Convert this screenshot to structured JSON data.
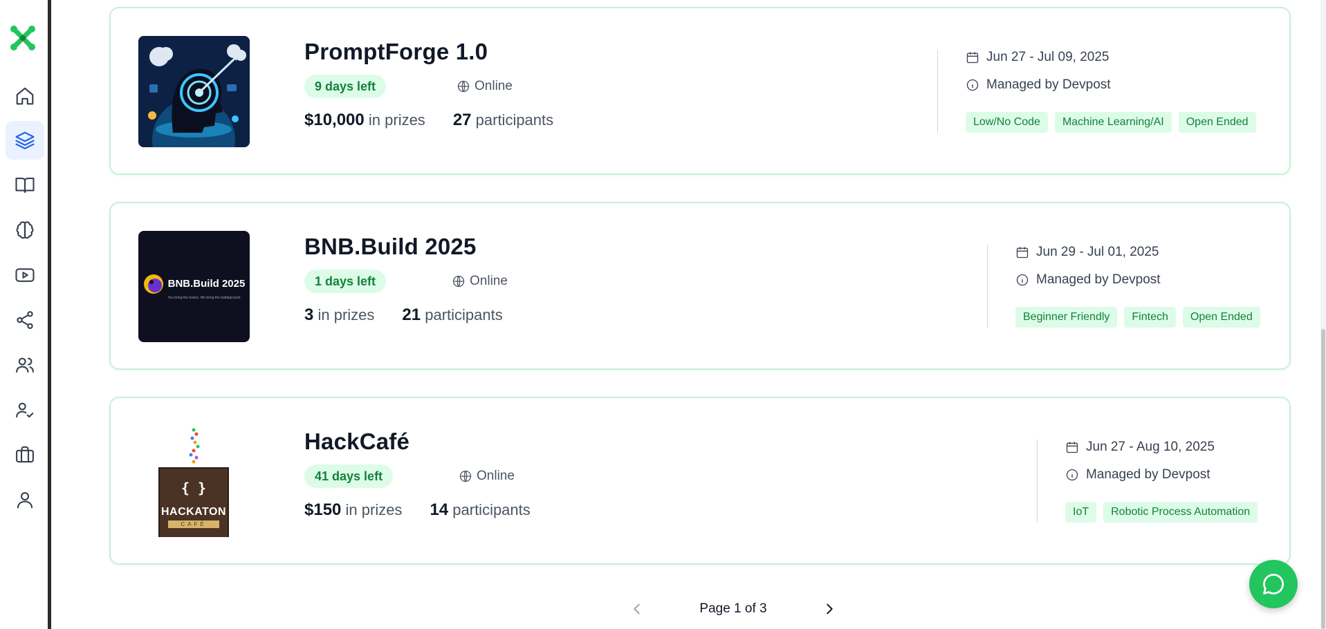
{
  "sidebar": {
    "items": [
      {
        "name": "home-icon"
      },
      {
        "name": "layers-icon",
        "active": true
      },
      {
        "name": "book-icon"
      },
      {
        "name": "brain-icon"
      },
      {
        "name": "video-icon"
      },
      {
        "name": "share-icon"
      },
      {
        "name": "users-icon"
      },
      {
        "name": "user-check-icon"
      },
      {
        "name": "briefcase-icon"
      },
      {
        "name": "user-icon"
      }
    ]
  },
  "hackathons": [
    {
      "title": "PromptForge 1.0",
      "days_left": "9 days left",
      "location": "Online",
      "prize_amount": "$10,000",
      "prize_suffix": "in prizes",
      "participants_count": "27",
      "participants_suffix": "participants",
      "dates": "Jun 27 - Jul 09, 2025",
      "managed_by": "Managed by Devpost",
      "tags": [
        "Low/No Code",
        "Machine Learning/AI",
        "Open Ended"
      ]
    },
    {
      "title": "BNB.Build 2025",
      "days_left": "1 days left",
      "location": "Online",
      "prize_amount": "3",
      "prize_suffix": "in prizes",
      "participants_count": "21",
      "participants_suffix": "participants",
      "dates": "Jun 29 - Jul 01, 2025",
      "managed_by": "Managed by Devpost",
      "tags": [
        "Beginner Friendly",
        "Fintech",
        "Open Ended"
      ],
      "thumb_text": "BNB.Build 2025",
      "thumb_subtext": "You bring the brains. We bring the battleground."
    },
    {
      "title": "HackCafé",
      "days_left": "41 days left",
      "location": "Online",
      "prize_amount": "$150",
      "prize_suffix": "in prizes",
      "participants_count": "14",
      "participants_suffix": "participants",
      "dates": "Jun 27 - Aug 10, 2025",
      "managed_by": "Managed by Devpost",
      "tags": [
        "IoT",
        "Robotic Process Automation"
      ],
      "thumb_text": "HACKATON",
      "thumb_subtext": "CAFÉ",
      "thumb_symbol": "{ }"
    }
  ],
  "pagination": {
    "label": "Page 1 of 3"
  },
  "colors": {
    "accent": "#22c55e",
    "badge_bg": "#dcfce7",
    "badge_text": "#15803d",
    "card_border": "#c7f0d6"
  }
}
